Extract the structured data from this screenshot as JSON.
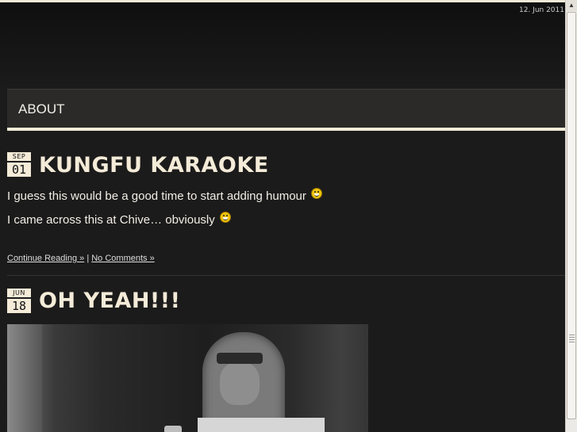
{
  "header": {
    "date": "12. Jun 2011"
  },
  "nav": {
    "items": [
      "ABOUT"
    ]
  },
  "posts": [
    {
      "month": "SEP",
      "day": "01",
      "title": "KUNGFU KARAOKE",
      "paragraphs": [
        "I guess this would be a good time to start adding humour",
        "I came across this at Chive… obviously"
      ],
      "continue_label": "Continue Reading »",
      "separator": "|",
      "comments_label": "No Comments »"
    },
    {
      "month": "JUN",
      "day": "18",
      "title": "OH YEAH!!!"
    }
  ],
  "icons": {
    "smiley": "smiley-grin-icon",
    "scroll_up": "scroll-up-arrow-icon"
  }
}
